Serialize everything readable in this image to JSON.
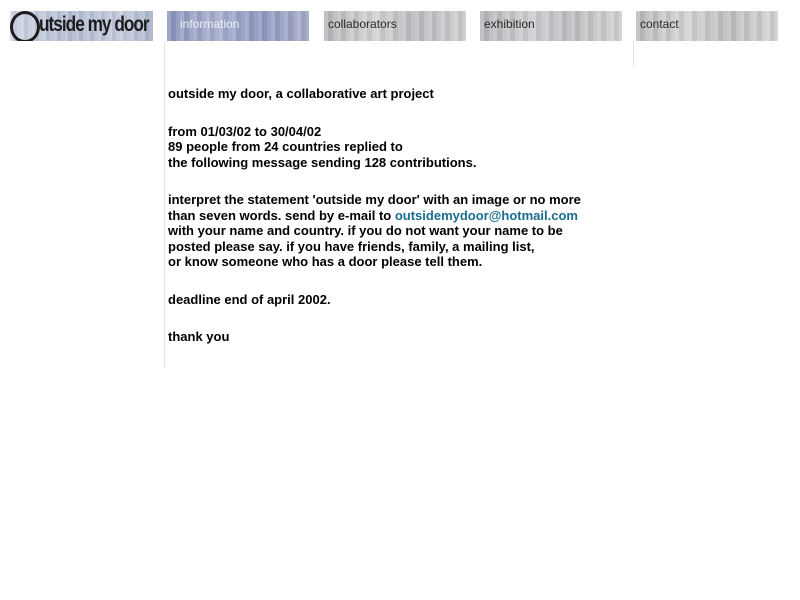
{
  "logo": {
    "text": "utside my door"
  },
  "nav": {
    "tabs": [
      {
        "id": "information",
        "label": "information",
        "active": true
      },
      {
        "id": "collaborators",
        "label": "collaborators",
        "active": false
      },
      {
        "id": "exhibition",
        "label": "exhibition",
        "active": false
      },
      {
        "id": "contact",
        "label": "contact",
        "active": false
      }
    ]
  },
  "content": {
    "title": "outside my door, a collaborative art project",
    "stats": {
      "line1": "from 01/03/02 to 30/04/02",
      "line2": "89 people from 24 countries replied to",
      "line3": "the following message sending 128 contributions."
    },
    "message": {
      "line1": "interpret the statement 'outside my door' with an image or no more",
      "line2_prefix": "than seven words. send by e-mail to ",
      "email": "outsidemydoor@hotmail.com",
      "line3": "with your name and country. if you do not want your name to be",
      "line4": "posted please say. if you have friends, family, a mailing list,",
      "line5": "or know someone who has a door please tell them."
    },
    "deadline": "deadline end of april 2002.",
    "closing": "thank you"
  },
  "colors": {
    "link": "#1b6c91",
    "active_tab": "#9aa2c6",
    "inactive_tab": "#c6c6c9"
  }
}
